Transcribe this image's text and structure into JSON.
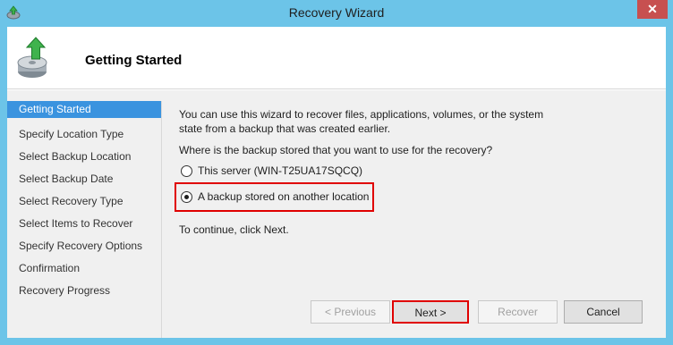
{
  "window": {
    "title": "Recovery Wizard",
    "close_label": "✕"
  },
  "header": {
    "title": "Getting Started"
  },
  "steps": [
    "Getting Started",
    "Specify Location Type",
    "Select Backup Location",
    "Select Backup Date",
    "Select Recovery Type",
    "Select Items to Recover",
    "Specify Recovery Options",
    "Confirmation",
    "Recovery Progress"
  ],
  "content": {
    "intro_line1": "You can use this wizard to recover files, applications, volumes, or the system",
    "intro_line2": "state from a backup that was created earlier.",
    "question": "Where is the backup stored that you want to use for the recovery?",
    "options": [
      {
        "label": "This server (WIN-T25UA17SQCQ)",
        "checked": false
      },
      {
        "label": "A backup stored on another location",
        "checked": true
      }
    ],
    "continue_text": "To continue, click Next."
  },
  "buttons": {
    "previous": "< Previous",
    "next": "Next >",
    "recover": "Recover",
    "cancel": "Cancel"
  },
  "colors": {
    "accent": "#3a93df",
    "highlight": "#e00000",
    "frame": "#6cc4e8"
  }
}
